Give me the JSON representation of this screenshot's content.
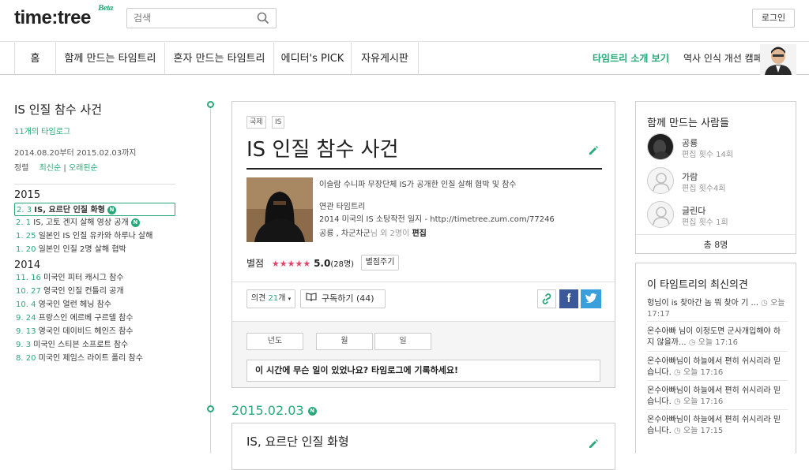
{
  "header": {
    "logo": "time:tree",
    "beta": "Beta",
    "search_placeholder": "검색",
    "login": "로그인"
  },
  "nav": {
    "items": [
      "홈",
      "함께 만드는 타임트리",
      "혼자 만드는 타임트리",
      "에디터's PICK",
      "자유게시판"
    ],
    "intro": "타임트리 소개 보기",
    "campaign": "역사 인식 개선 캠페인"
  },
  "left": {
    "title": "IS 인질 참수 사건",
    "count": "11개의 타임로그",
    "range": "2014.08.20부터 2015.02.03까지",
    "sort_label": "정렬",
    "sort_new": "최신순",
    "sort_sep": "|",
    "sort_old": "오래된순",
    "years": [
      {
        "year": "2015",
        "items": [
          {
            "date": "2.  3",
            "text": "IS, 요르단 인질 화형",
            "badge": "N",
            "selected": true
          },
          {
            "date": "2.  1",
            "text": "IS, 고토 겐지 살해 영상 공개",
            "badge": "N"
          },
          {
            "date": "1. 25",
            "text": "일본인 IS 인질 유카와 하루나 살해"
          },
          {
            "date": "1. 20",
            "text": "일본인 인질 2명 살해 협박"
          }
        ]
      },
      {
        "year": "2014",
        "items": [
          {
            "date": "11. 16",
            "text": "미국인 피터 캐시그 참수"
          },
          {
            "date": "10. 27",
            "text": "영국인 인질 컨틀리 공개"
          },
          {
            "date": "10.  4",
            "text": "영국인 얼런 헤닝 참수"
          },
          {
            "date": "9. 24",
            "text": "프랑스인 에르베 구르델 참수"
          },
          {
            "date": "9. 13",
            "text": "영국인 데이비드 헤인즈 참수"
          },
          {
            "date": "9.  3",
            "text": "미국인 스티븐 소프로트 참수"
          },
          {
            "date": "8. 20",
            "text": "미국인 제임스 라이트 폴리 참수"
          }
        ]
      }
    ]
  },
  "card": {
    "tags": [
      "국제",
      "IS"
    ],
    "title": "IS 인질 참수 사건",
    "desc": "이슬람 수니파 무장단체 IS가 공개한 인질 살해 협박 및 참수",
    "related_label": "연관 타임트리",
    "related": "2014 미국의 IS 소탕작전 일지 - http://timetree.zum.com/77246",
    "editors_names": "공룡 , 차군차군",
    "editors_mid": "님 외 2명이",
    "editors_action": "편집",
    "rating_label": "별점",
    "stars": "★★★★★",
    "rating": "5.0",
    "rating_count": "(28명)",
    "rate_button": "별점주기",
    "opinion_label": "의견",
    "opinion_count": "21",
    "opinion_unit": "개",
    "subscribe": "구독하기 (44)",
    "date_year": "년도",
    "date_month": "월",
    "date_day": "일",
    "prompt": "이 시간에 무슨 일이 있었나요? 타임로그에 기록하세요!"
  },
  "entry": {
    "date": "2015.02.03",
    "badge": "N",
    "title": "IS, 요르단 인질 화형"
  },
  "people": {
    "title": "함께 만드는 사람들",
    "list": [
      {
        "name": "공룡",
        "count": "편집 횟수 14회"
      },
      {
        "name": "가람",
        "count": "편집 횟수4회"
      },
      {
        "name": "글린다",
        "count": "편집 횟수 1회"
      }
    ],
    "total": "총 8명"
  },
  "opinions": {
    "title": "이 타임트리의 최신의견",
    "list": [
      {
        "text": "헝님이 is 찾아간 놈 뭐 찾아 기 ...",
        "time": "오늘 17:17"
      },
      {
        "text": "온수아빠 님이 이정도면 군사개입해야 하지 않을까...",
        "time": "오늘 17:16"
      },
      {
        "text": "온수아빠님이 하늘에서 편히 쉬시리라 믿습니다.",
        "time": "오늘 17:16"
      },
      {
        "text": "온수아빠님이 하늘에서 편히 쉬시리라 믿습니다.",
        "time": "오늘 17:16"
      },
      {
        "text": "온수아빠님이 하늘에서 편히 쉬시리라 믿습니다.",
        "time": "오늘 17:15"
      }
    ]
  },
  "colors": {
    "accent": "#2aa87a",
    "facebook": "#3b5998",
    "twitter": "#3aa0dc"
  }
}
